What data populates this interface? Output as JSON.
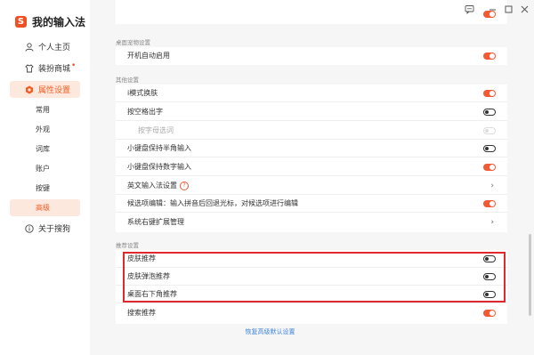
{
  "app": {
    "title": "我的输入法"
  },
  "sidebar": {
    "items": [
      {
        "label": "个人主页",
        "icon": "person-icon"
      },
      {
        "label": "装扮商城",
        "icon": "shirt-icon",
        "dot": "•"
      },
      {
        "label": "属性设置",
        "icon": "hexagon-settings-icon",
        "active": true
      },
      {
        "label": "关于搜狗",
        "icon": "info-icon"
      }
    ],
    "subitems": [
      "常用",
      "外观",
      "词库",
      "账户",
      "按键",
      "高级"
    ]
  },
  "window_controls": [
    "chat-icon",
    "minimize-icon",
    "maximize-icon",
    "close-icon"
  ],
  "sections": {
    "desktop": {
      "label": "桌面宠物设置",
      "rows": [
        {
          "label": "开机自动启用",
          "toggle": "on"
        }
      ]
    },
    "other": {
      "label": "其他设置",
      "rows": [
        {
          "label": "i模式换肤",
          "toggle": "on"
        },
        {
          "label": "按空格出字",
          "toggle": "off"
        },
        {
          "label": "按字母选词",
          "toggle": "disabled"
        },
        {
          "label": "小键盘保持半角输入",
          "toggle": "off"
        },
        {
          "label": "小键盘保持数字输入",
          "toggle": "on"
        },
        {
          "label": "英文输入法设置",
          "help": "?",
          "chevron": "›"
        },
        {
          "label": "候选项编辑：输入拼音后回退光标，对候选项进行编辑",
          "toggle": "on"
        },
        {
          "label": "系统右键扩展管理",
          "chevron": "›"
        }
      ]
    },
    "recommend": {
      "label": "推荐设置",
      "rows": [
        {
          "label": "皮肤推荐",
          "toggle": "off"
        },
        {
          "label": "皮肤弹泡推荐",
          "toggle": "off"
        },
        {
          "label": "桌面右下角推荐",
          "toggle": "off"
        },
        {
          "label": "搜索推荐",
          "toggle": "on"
        }
      ]
    }
  },
  "footer": {
    "reset_label": "恢复高级默认设置"
  },
  "colors": {
    "accent": "#f25a35",
    "highlight": "#e0282e",
    "link": "#3f84d9"
  }
}
